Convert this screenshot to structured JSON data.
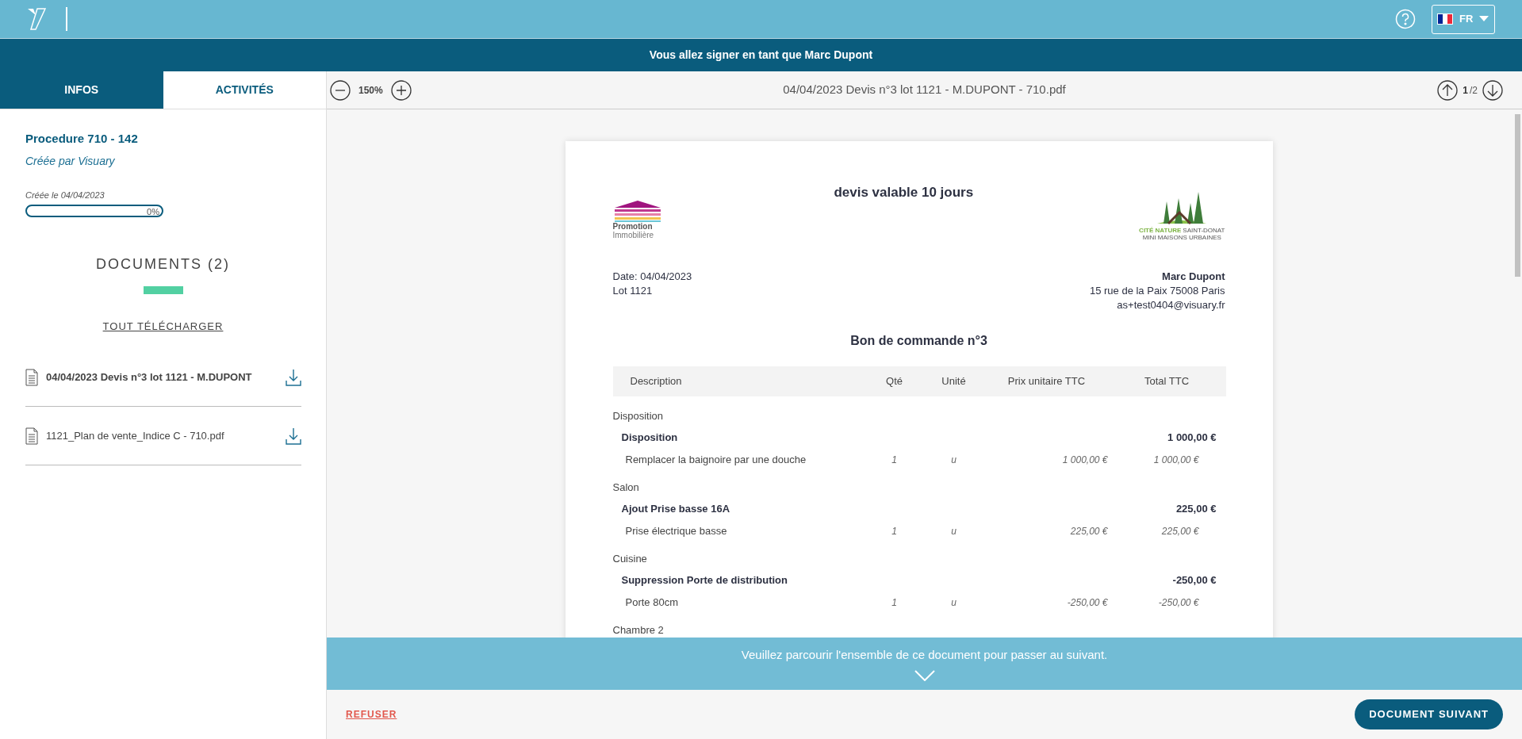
{
  "header": {
    "language": "FR"
  },
  "banner": "Vous allez signer en tant que Marc Dupont",
  "tabs": [
    {
      "label": "INFOS",
      "selected": true
    },
    {
      "label": "ACTIVITÉS",
      "selected": false
    }
  ],
  "procedure": {
    "title": "Procedure 710 - 142",
    "creator": "Créée par Visuary",
    "created": "Créée le 04/04/2023",
    "progress": {
      "level": 0,
      "reading": "0%"
    }
  },
  "documents": {
    "heading": "DOCUMENTS (2)",
    "download_all": "TOUT TÉLÉCHARGER",
    "items": [
      {
        "name": "04/04/2023 Devis n°3 lot 1121 - M.DUPONT",
        "selected": true
      },
      {
        "name": "1121_Plan de vente_Indice C - 710.pdf",
        "selected": false
      }
    ]
  },
  "viewer": {
    "zoom": "150%",
    "filename": "04/04/2023 Devis n°3 lot 1121 - M.DUPONT - 710.pdf",
    "page": "1",
    "pages": "/2"
  },
  "document": {
    "title": "devis valable 10 jours",
    "logo_left": [
      "Promotion",
      "Immobilière"
    ],
    "logo_right": [
      "CITÉ NATURE",
      "SAINT-DONAT",
      "MINI MAISONS URBAINES"
    ],
    "info": [
      "Date: 04/04/2023",
      "Lot 1121"
    ],
    "client": {
      "name": "Marc Dupont",
      "address": "15 rue de la Paix 75008 Paris",
      "email": "as+test0404@visuary.fr"
    },
    "order_title": "Bon de commande n°3",
    "columns": [
      "Description",
      "Qté",
      "Unité",
      "Prix unitaire TTC",
      "Total TTC"
    ],
    "sections": [
      {
        "name": "Disposition",
        "items": [
          {
            "title": "Disposition",
            "total": "1 000,00 €",
            "lines": [
              {
                "description": "Remplacer la baignoire par une douche",
                "qty": "1",
                "unit": "u",
                "unit_price": "1 000,00 €",
                "total": "1 000,00 €"
              }
            ]
          }
        ]
      },
      {
        "name": "Salon",
        "items": [
          {
            "title": "Ajout Prise basse 16A",
            "total": "225,00 €",
            "lines": [
              {
                "description": "Prise électrique basse",
                "qty": "1",
                "unit": "u",
                "unit_price": "225,00 €",
                "total": "225,00 €"
              }
            ]
          }
        ]
      },
      {
        "name": "Cuisine",
        "items": [
          {
            "title": "Suppression Porte de distribution",
            "total": "-250,00 €",
            "lines": [
              {
                "description": "Porte 80cm",
                "qty": "1",
                "unit": "u",
                "unit_price": "-250,00 €",
                "total": "-250,00 €"
              }
            ]
          }
        ]
      },
      {
        "name": "Chambre 2"
      }
    ]
  },
  "overlay": {
    "message": "Veuillez parcourir l'ensemble de ce document pour passer au suivant."
  },
  "footer": {
    "refuse": "REFUSER",
    "next": "DOCUMENT SUIVANT"
  }
}
